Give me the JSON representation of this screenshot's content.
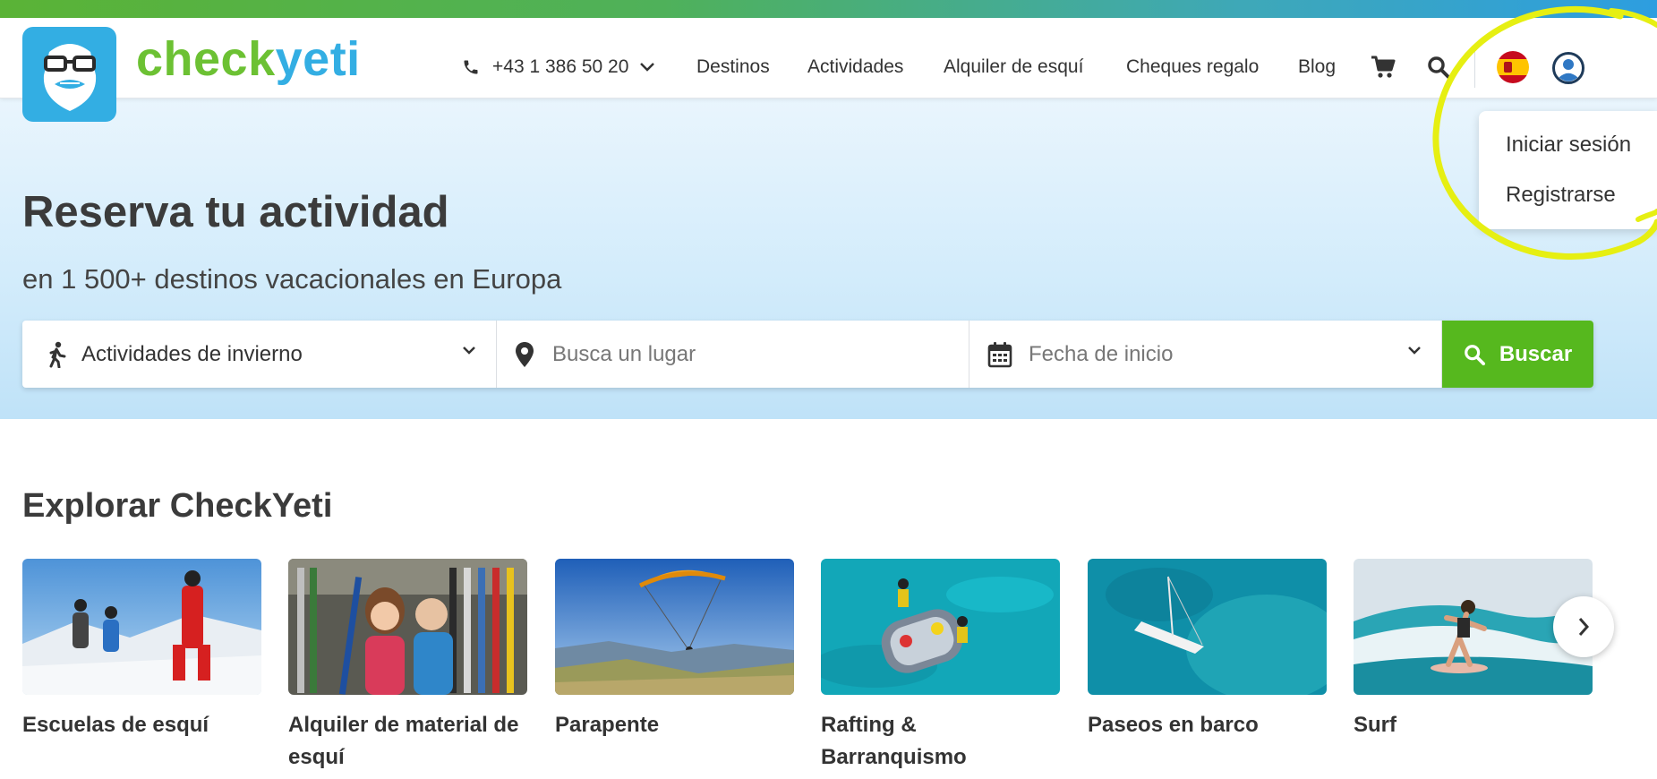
{
  "brand": {
    "part1": "check",
    "part2": "yeti"
  },
  "header": {
    "phone": "+43 1 386 50 20",
    "nav": [
      "Destinos",
      "Actividades",
      "Alquiler de esquí",
      "Cheques regalo",
      "Blog"
    ]
  },
  "account_menu": {
    "login": "Iniciar sesión",
    "register": "Registrarse"
  },
  "hero": {
    "title": "Reserva tu actividad",
    "subtitle": "en 1 500+ destinos vacacionales en Europa"
  },
  "search": {
    "activity_value": "Actividades de invierno",
    "place_placeholder": "Busca un lugar",
    "date_placeholder": "Fecha de inicio",
    "button": "Buscar"
  },
  "explore": {
    "title": "Explorar CheckYeti",
    "cards": [
      {
        "label": "Escuelas de esquí"
      },
      {
        "label": "Alquiler de material de esquí"
      },
      {
        "label": "Parapente"
      },
      {
        "label": "Rafting & Barranquismo"
      },
      {
        "label": "Paseos en barco"
      },
      {
        "label": "Surf"
      }
    ]
  },
  "colors": {
    "brand_green": "#6cc133",
    "brand_blue": "#33aee3",
    "search_button": "#56b81e",
    "annotation": "#e6ef12"
  }
}
